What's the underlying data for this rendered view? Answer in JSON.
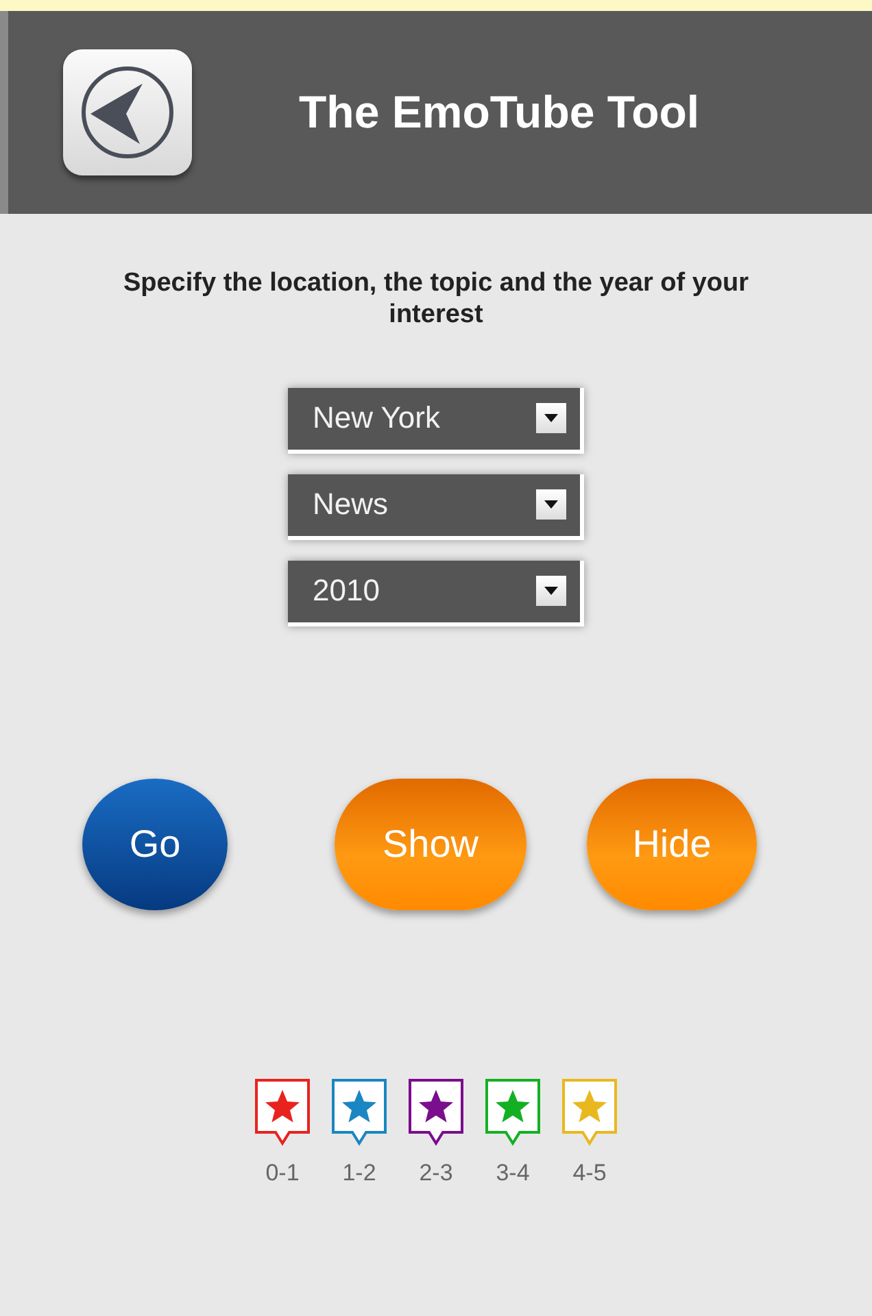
{
  "header": {
    "title": "The EmoTube Tool"
  },
  "instruction": "Specify the location, the topic and the year of your interest",
  "selects": [
    {
      "value": "New York"
    },
    {
      "value": "News"
    },
    {
      "value": "2010"
    }
  ],
  "buttons": [
    {
      "label": "Go",
      "kind": "round"
    },
    {
      "label": "Show",
      "kind": "pill"
    },
    {
      "label": "Hide",
      "kind": "pill"
    }
  ],
  "legend": [
    {
      "label": "0-1",
      "color": "#e8231e"
    },
    {
      "label": "1-2",
      "color": "#1a86c2"
    },
    {
      "label": "2-3",
      "color": "#7a0e8c"
    },
    {
      "label": "3-4",
      "color": "#14b024"
    },
    {
      "label": "4-5",
      "color": "#e8b81e"
    }
  ]
}
